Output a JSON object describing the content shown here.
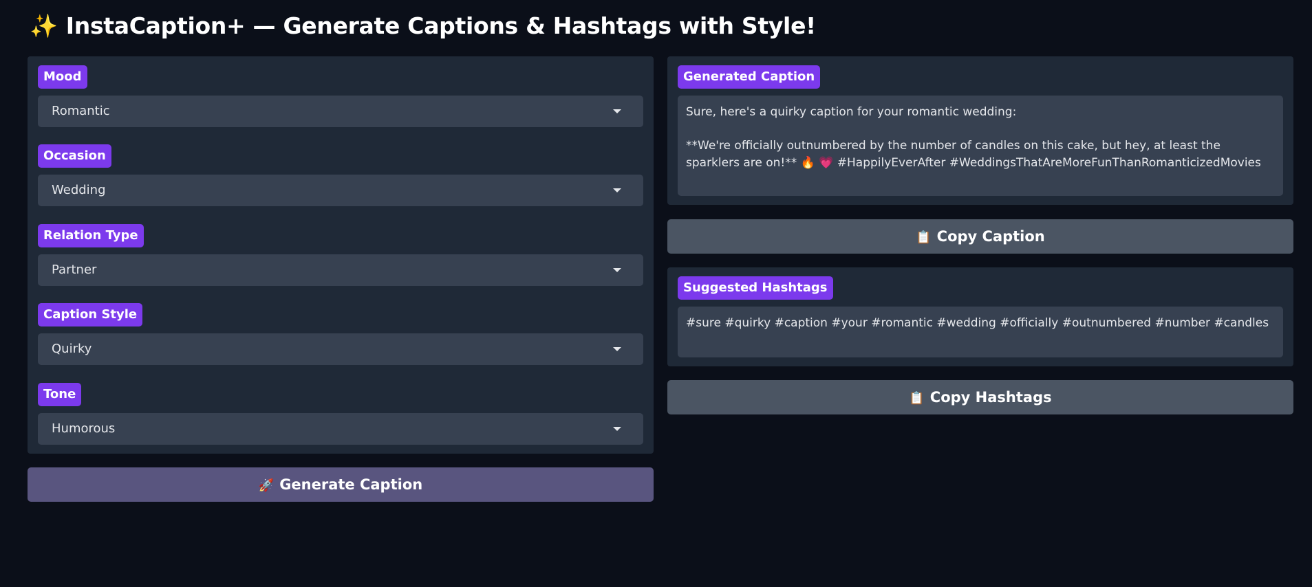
{
  "header": {
    "emoji": "✨",
    "title": "InstaCaption+ — Generate Captions & Hashtags with Style!"
  },
  "form": {
    "mood": {
      "label": "Mood",
      "value": "Romantic"
    },
    "occasion": {
      "label": "Occasion",
      "value": "Wedding"
    },
    "relation_type": {
      "label": "Relation Type",
      "value": "Partner"
    },
    "caption_style": {
      "label": "Caption Style",
      "value": "Quirky"
    },
    "tone": {
      "label": "Tone",
      "value": "Humorous"
    }
  },
  "generate_button": {
    "emoji": "🚀",
    "label": "Generate Caption"
  },
  "caption_output": {
    "label": "Generated Caption",
    "text": "Sure, here's a quirky caption for your romantic wedding:\n\n**We're officially outnumbered by the number of candles on this cake, but hey, at least the sparklers are on!** 🔥 💗 #HappilyEverAfter #WeddingsThatAreMoreFunThanRomanticizedMovies"
  },
  "copy_caption_button": {
    "emoji": "📋",
    "label": "Copy Caption"
  },
  "hashtags_output": {
    "label": "Suggested Hashtags",
    "text": "#sure #quirky #caption #your #romantic #wedding #officially #outnumbered #number #candles"
  },
  "copy_hashtags_button": {
    "emoji": "📋",
    "label": "Copy Hashtags"
  },
  "colors": {
    "background": "#0b0f19",
    "panel": "#1f2937",
    "label_accent": "#7c3aed",
    "input": "#374151",
    "generate_button": "#59557f",
    "copy_button": "#4b5563"
  },
  "icons": {
    "title": "sparkles-icon",
    "generate": "rocket-icon",
    "copy": "clipboard-icon",
    "dropdown": "chevron-down-icon"
  }
}
